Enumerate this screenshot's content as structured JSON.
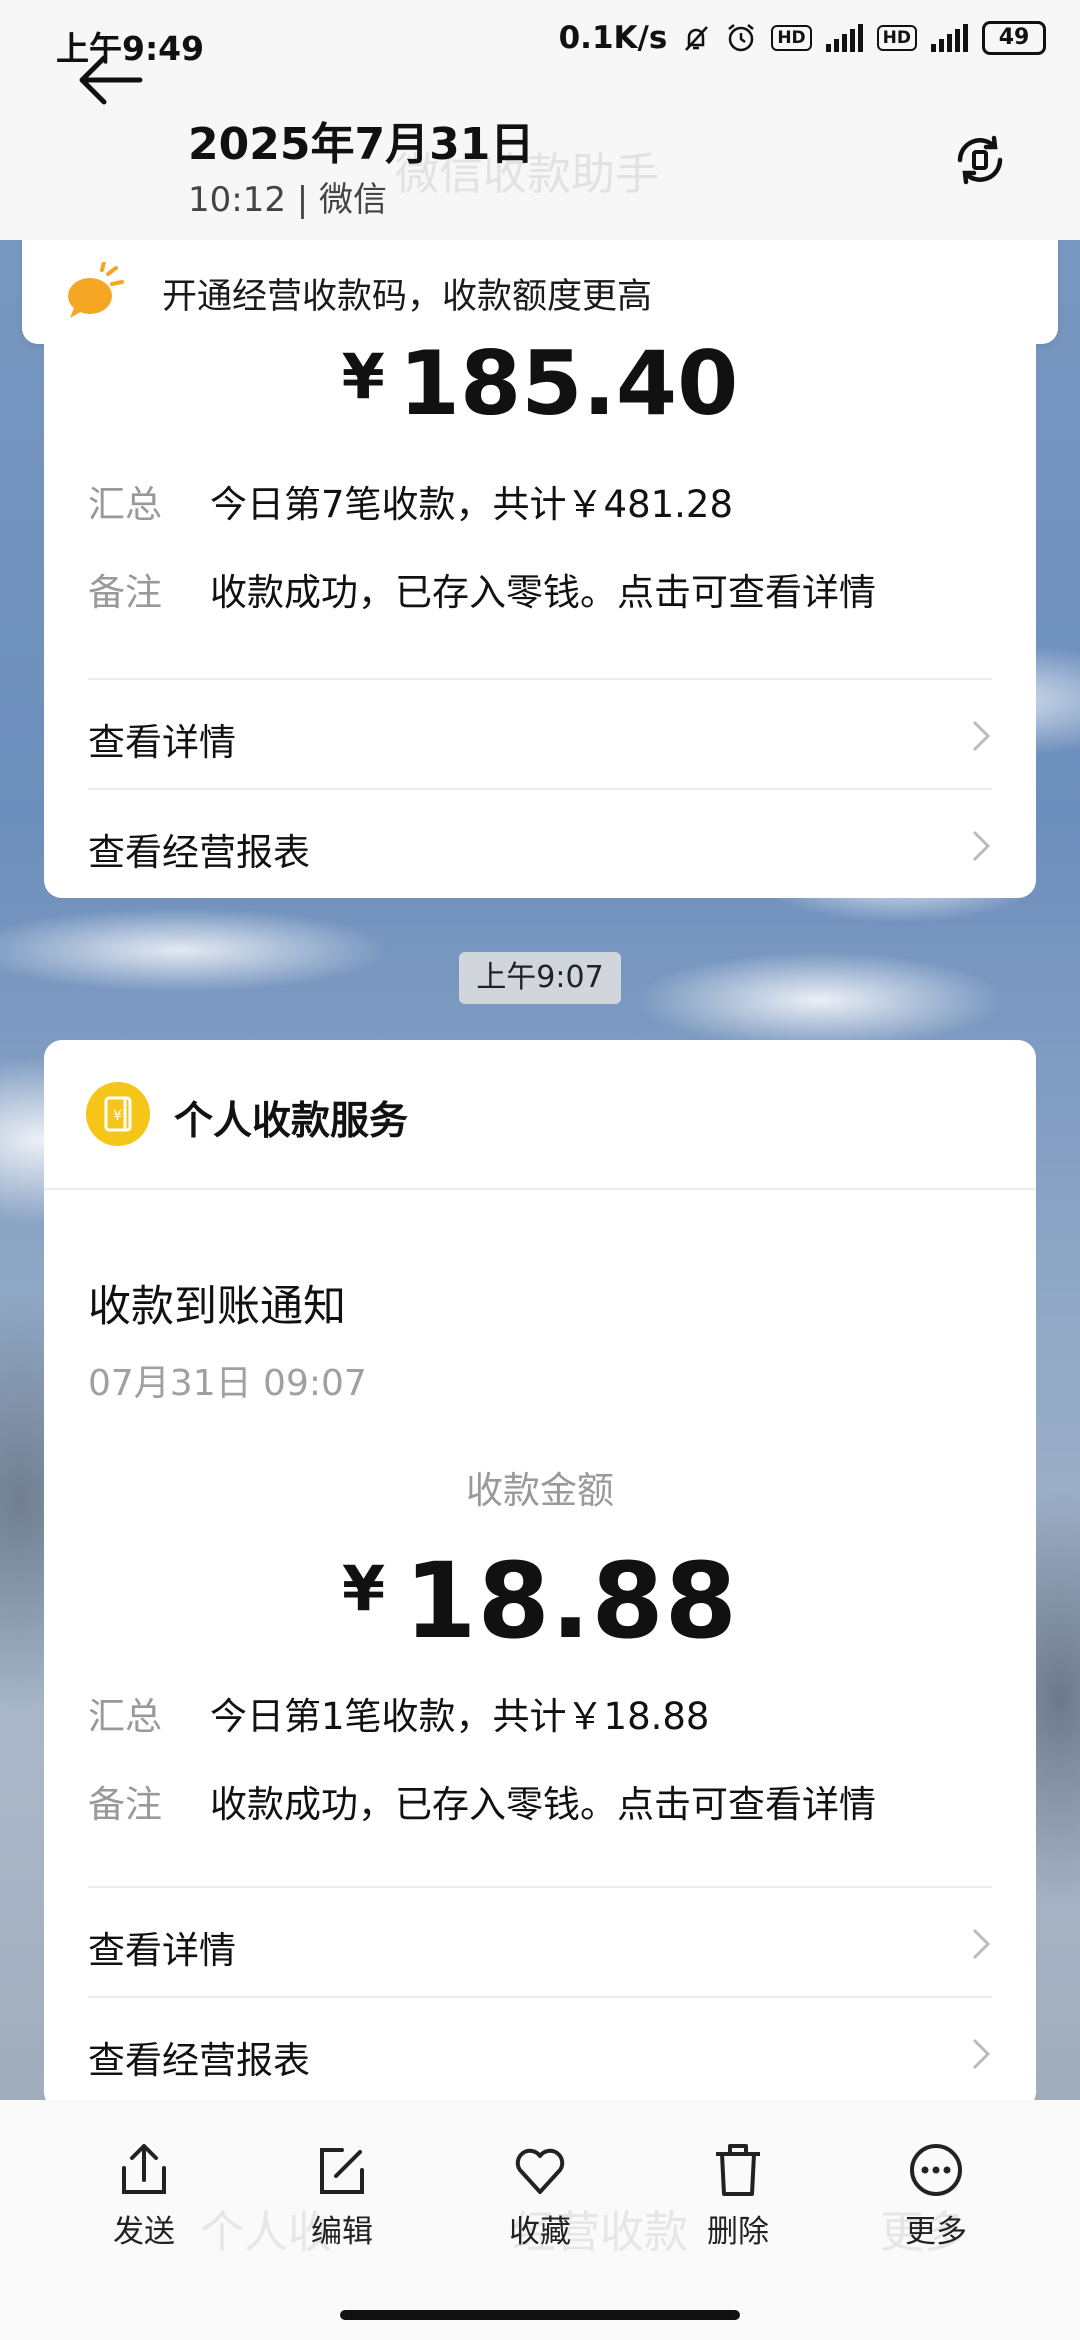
{
  "status_bar": {
    "time": "上午9:49",
    "net_speed": "0.1K/s",
    "hd1": "HD",
    "hd2": "HD",
    "battery": "49"
  },
  "header": {
    "title": "2025年7月31日",
    "subtitle": "10:12 | 微信",
    "ghost_title": "微信收款助手"
  },
  "banner": {
    "text": "开通经营收款码，收款额度更高"
  },
  "card1": {
    "currency": "¥",
    "amount": "185.40",
    "summary_label": "汇总",
    "summary_value": "今日第7笔收款，共计￥481.28",
    "note_label": "备注",
    "note_value": "收款成功，已存入零钱。点击可查看详情",
    "link1": "查看详情",
    "link2": "查看经营报表"
  },
  "time_chip": "上午9:07",
  "card2": {
    "service_title": "个人收款服务",
    "service_icon_glyph": "¥",
    "notif_title": "收款到账通知",
    "notif_date": "07月31日 09:07",
    "amount_label": "收款金额",
    "currency": "¥",
    "amount": "18.88",
    "summary_label": "汇总",
    "summary_value": "今日第1笔收款，共计￥18.88",
    "note_label": "备注",
    "note_value": "收款成功，已存入零钱。点击可查看详情",
    "link1": "查看详情",
    "link2": "查看经营报表"
  },
  "toolbar": {
    "send": "发送",
    "edit": "编辑",
    "favorite": "收藏",
    "delete": "删除",
    "more": "更多",
    "ghost_left": "个人收",
    "ghost_mid": "经营收款",
    "ghost_right": "更多"
  },
  "colors": {
    "accent_yellow": "#f5c518",
    "text_primary": "#111111",
    "text_secondary": "#999999"
  }
}
